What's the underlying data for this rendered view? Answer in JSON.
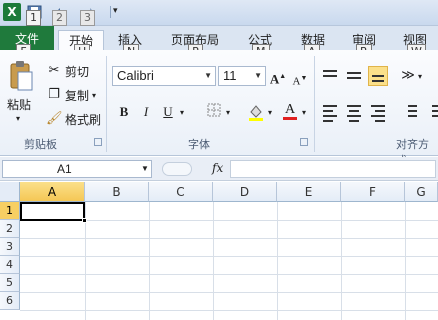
{
  "qat": {
    "logo_icon": "excel-logo-icon",
    "keytips": [
      "1",
      "2",
      "3"
    ]
  },
  "tabs": [
    {
      "label": "文件",
      "keytip": "F"
    },
    {
      "label": "开始",
      "keytip": "H"
    },
    {
      "label": "插入",
      "keytip": "N"
    },
    {
      "label": "页面布局",
      "keytip": "P"
    },
    {
      "label": "公式",
      "keytip": "M"
    },
    {
      "label": "数据",
      "keytip": "A"
    },
    {
      "label": "审阅",
      "keytip": "R"
    },
    {
      "label": "视图",
      "keytip": "W"
    }
  ],
  "clipboard": {
    "paste_label": "粘贴",
    "cut_label": "剪切",
    "copy_label": "复制",
    "format_painter_label": "格式刷",
    "group_label": "剪贴板"
  },
  "font": {
    "font_name": "Calibri",
    "font_size": "11",
    "bold": "B",
    "italic": "I",
    "underline": "U",
    "grow": "A",
    "shrink": "A",
    "color_letter": "A",
    "group_label": "字体"
  },
  "alignment": {
    "group_label": "对齐方式"
  },
  "formula_bar": {
    "name_box": "A1",
    "fx": "fx"
  },
  "grid": {
    "columns": [
      "A",
      "B",
      "C",
      "D",
      "E",
      "F",
      "G"
    ],
    "rows": [
      "1",
      "2",
      "3",
      "4",
      "5",
      "6"
    ],
    "active_cell": "A1"
  },
  "colors": {
    "file_tab": "#1f7a3c",
    "selected_header": "#f7cf63",
    "accent_highlight": "#fbe08a"
  }
}
